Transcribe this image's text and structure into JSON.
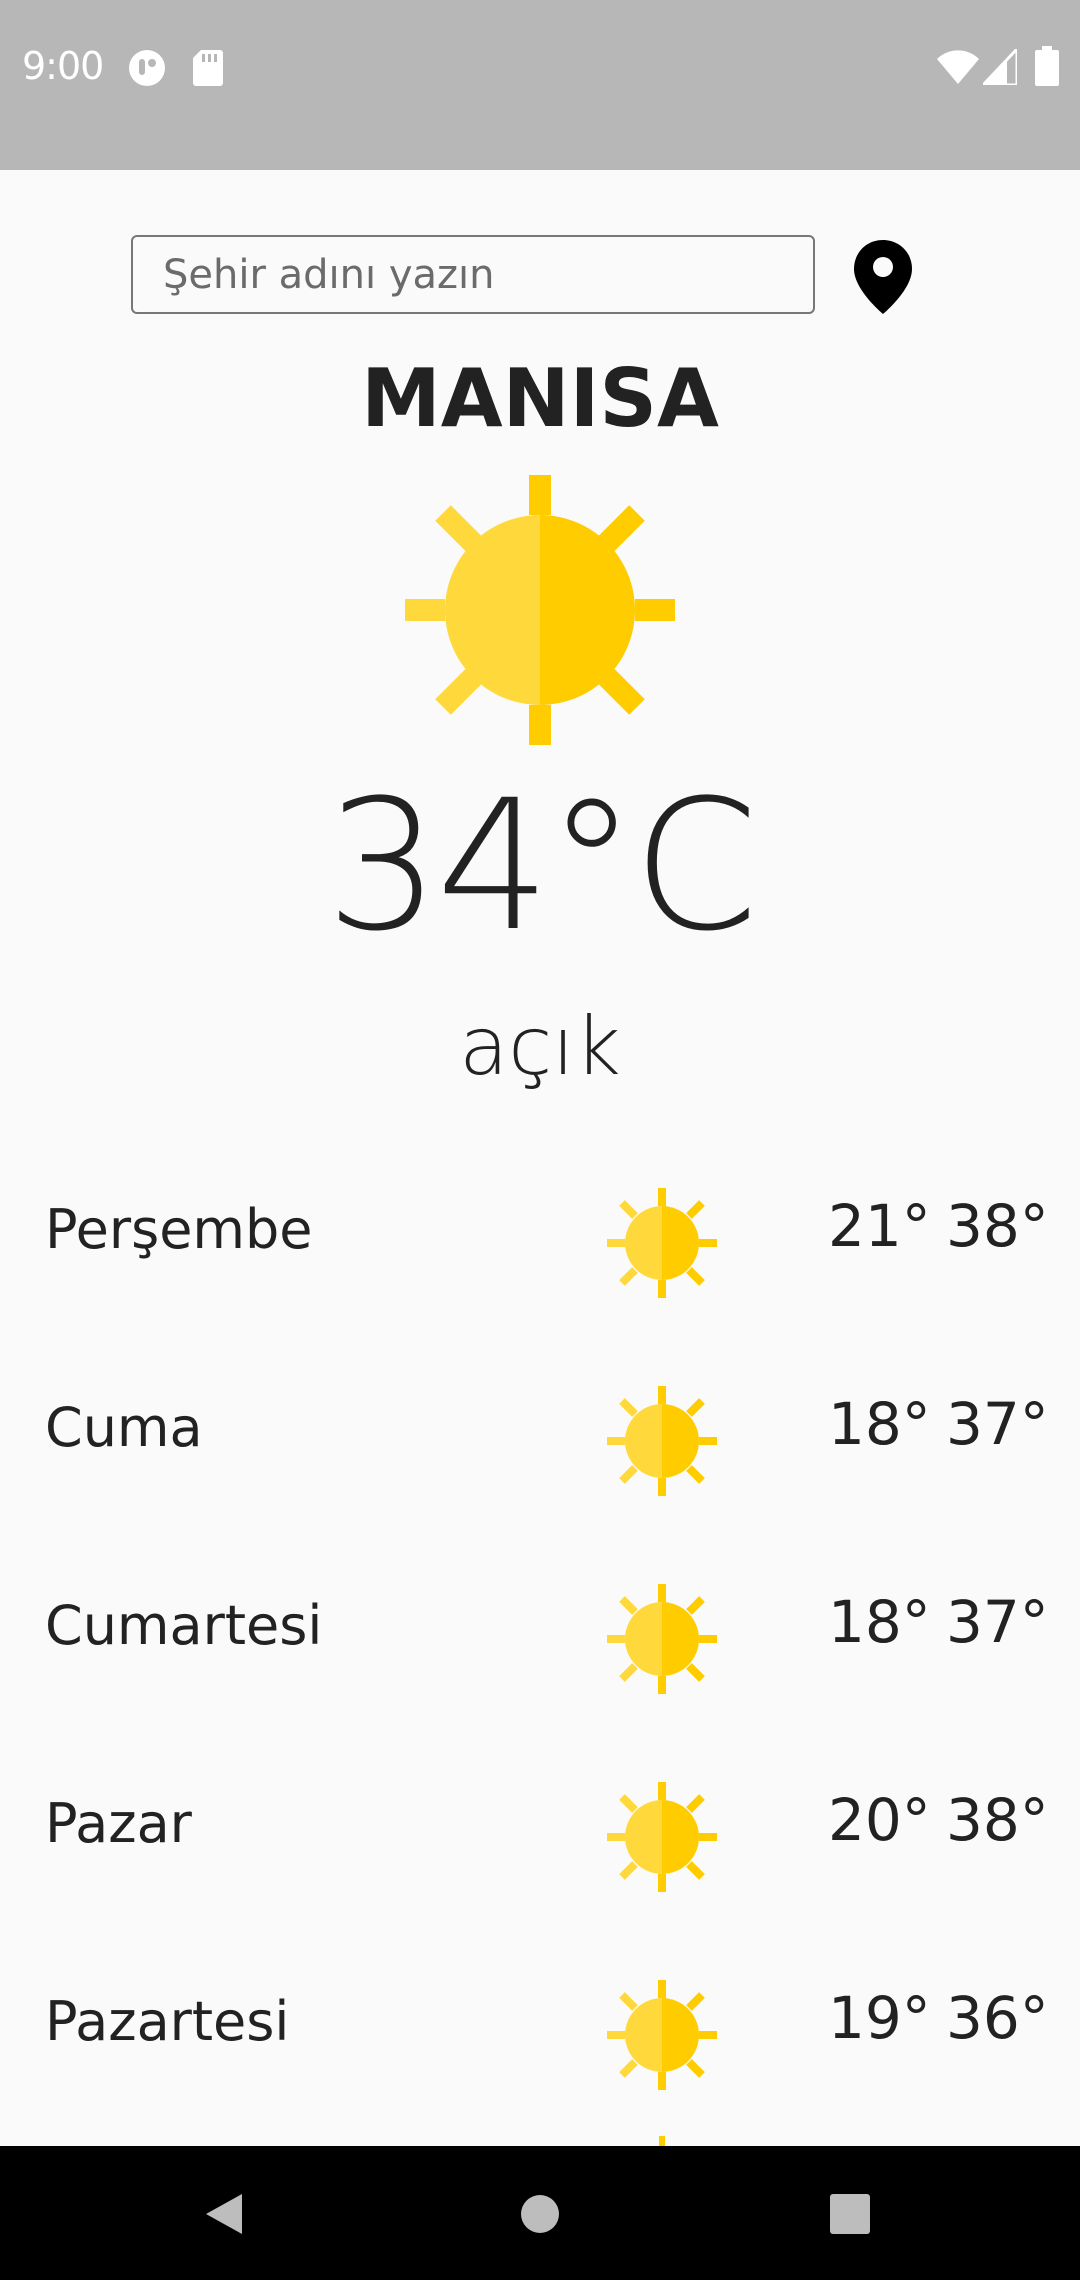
{
  "status_bar": {
    "time": "9:00",
    "left_icons": [
      "assistant-icon",
      "sd-card-icon"
    ],
    "right_icons": [
      "wifi-icon",
      "signal-icon",
      "battery-icon"
    ],
    "background": "#b7b7b7"
  },
  "search": {
    "placeholder": "Şehir adını yazın",
    "value": ""
  },
  "location_icon": "location-pin-icon",
  "current": {
    "city": "MANISA",
    "icon": "sun-icon",
    "temperature": "34°C",
    "description": "açık"
  },
  "forecast": [
    {
      "day": "Perşembe",
      "icon": "sun-icon",
      "min": "21°",
      "max": "38°"
    },
    {
      "day": "Cuma",
      "icon": "sun-icon",
      "min": "18°",
      "max": "37°"
    },
    {
      "day": "Cumartesi",
      "icon": "sun-icon",
      "min": "18°",
      "max": "37°"
    },
    {
      "day": "Pazar",
      "icon": "sun-icon",
      "min": "20°",
      "max": "38°"
    },
    {
      "day": "Pazartesi",
      "icon": "sun-icon",
      "min": "19°",
      "max": "36°"
    }
  ],
  "nav_bar": {
    "buttons": [
      "back-icon",
      "home-icon",
      "recents-icon"
    ]
  },
  "colors": {
    "sun_light": "#ffd93b",
    "sun_dark": "#ffcc00",
    "text": "#222222",
    "background": "#fafafa"
  }
}
